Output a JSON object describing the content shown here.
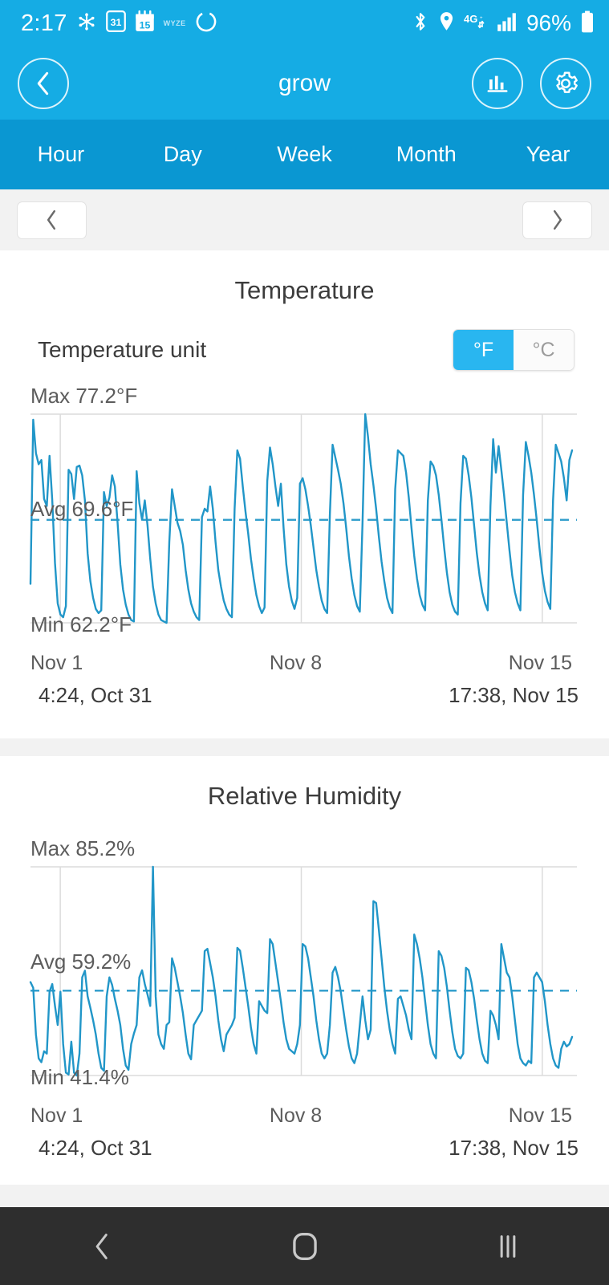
{
  "status_bar": {
    "time": "2:17",
    "battery_percent": "96%",
    "wyze_label": "WYZE",
    "icons": [
      "snowflake-icon",
      "sim-calendar-31-icon",
      "calendar-15-icon",
      "wyze-icon",
      "bixby-circle-icon",
      "bluetooth-icon",
      "location-pin-icon",
      "4g-data-icon",
      "signal-bars-icon",
      "battery-icon"
    ]
  },
  "app_bar": {
    "title": "grow",
    "back_label": "Back",
    "chart_button_label": "Chart",
    "settings_button_label": "Settings"
  },
  "tabs": {
    "items": [
      {
        "label": "Hour",
        "active": false
      },
      {
        "label": "Day",
        "active": false
      },
      {
        "label": "Week",
        "active": false
      },
      {
        "label": "Month",
        "active": true
      },
      {
        "label": "Year",
        "active": false
      }
    ]
  },
  "range_nav": {
    "prev_label": "Previous period",
    "next_label": "Next period"
  },
  "temperature": {
    "title": "Temperature",
    "unit_row_label": "Temperature unit",
    "unit_options": [
      {
        "label": "°F",
        "selected": true
      },
      {
        "label": "°C",
        "selected": false
      }
    ],
    "max_label": "Max 77.2°F",
    "avg_label": "Avg 69.6°F",
    "min_label": "Min 62.2°F",
    "x_ticks": [
      "Nov 1",
      "Nov 8",
      "Nov 15"
    ],
    "range_start": "4:24, Oct 31",
    "range_end": "17:38, Nov 15"
  },
  "humidity": {
    "title": "Relative Humidity",
    "max_label": "Max 85.2%",
    "avg_label": "Avg 59.2%",
    "min_label": "Min 41.4%",
    "x_ticks": [
      "Nov 1",
      "Nov 8",
      "Nov 15"
    ],
    "range_start": "4:24, Oct 31",
    "range_end": "17:38, Nov 15"
  },
  "android_nav": {
    "back_label": "Back",
    "home_label": "Home",
    "recents_label": "Recent apps"
  },
  "colors": {
    "header_blue": "#15ace4",
    "tab_blue": "#0a97d2",
    "accent_blue": "#29b6f0",
    "line_blue": "#2196c8",
    "page_bg": "#f2f2f2",
    "card_bg": "#ffffff",
    "text_dark": "#3c3c3c",
    "text_muted": "#5c5c5c",
    "nav_bar": "#2e2e2e"
  },
  "chart_data": [
    {
      "type": "line",
      "title": "Temperature",
      "id": "temperature",
      "ylabel": "°F",
      "xlabel": "",
      "ylim": [
        62.2,
        77.2
      ],
      "max": 77.2,
      "avg": 69.6,
      "min": 62.2,
      "unit": "°F",
      "grid": true,
      "gridlines_x": [
        "Nov 1",
        "Nov 8",
        "Nov 15"
      ],
      "avg_line": 69.6,
      "x_start": "4:24, Oct 31",
      "x_end": "17:38, Nov 15",
      "x_tick_labels": [
        "Nov 1",
        "Nov 8",
        "Nov 15"
      ],
      "legend": [],
      "description": "Daily sawtooth cycle: sharp rise to daytime peak with plateau, then steady decay to overnight minimum; 16 day-cycles across Oct 31 to Nov 15.",
      "series": [
        {
          "name": "Temperature",
          "color": "#2196c8",
          "values": [
            65.0,
            76.8,
            74.4,
            73.6,
            73.9,
            71.1,
            70.6,
            74.2,
            71.0,
            66.5,
            63.6,
            62.8,
            62.6,
            63.4,
            73.2,
            72.9,
            71.1,
            73.4,
            73.5,
            72.8,
            71.0,
            67.2,
            65.2,
            64.0,
            63.2,
            62.9,
            63.1,
            71.6,
            70.6,
            71.2,
            72.8,
            72.0,
            69.4,
            66.4,
            64.6,
            63.5,
            62.8,
            62.4,
            62.3,
            73.1,
            70.8,
            69.6,
            71.0,
            69.2,
            66.8,
            64.8,
            63.6,
            62.8,
            62.4,
            62.3,
            62.2,
            68.0,
            71.8,
            70.6,
            69.4,
            68.8,
            67.8,
            66.0,
            64.6,
            63.6,
            63.0,
            62.6,
            62.4,
            69.8,
            70.4,
            70.2,
            72.0,
            70.4,
            68.0,
            66.0,
            64.8,
            63.8,
            63.2,
            62.8,
            62.6,
            70.4,
            74.6,
            74.0,
            72.0,
            70.2,
            68.6,
            66.8,
            65.4,
            64.2,
            63.4,
            62.9,
            63.3,
            72.4,
            74.8,
            73.6,
            72.0,
            70.6,
            72.2,
            69.0,
            66.4,
            64.8,
            63.8,
            63.2,
            64.0,
            72.2,
            72.6,
            71.8,
            70.6,
            69.2,
            67.6,
            66.0,
            64.8,
            63.8,
            63.2,
            62.9,
            70.0,
            75.0,
            74.1,
            73.2,
            72.2,
            70.8,
            69.0,
            67.0,
            65.4,
            64.2,
            63.4,
            63.0,
            69.4,
            77.2,
            75.6,
            73.6,
            72.1,
            70.4,
            68.4,
            66.6,
            65.2,
            64.0,
            63.3,
            62.9,
            71.8,
            74.6,
            74.4,
            74.2,
            73.0,
            71.2,
            69.0,
            67.0,
            65.4,
            64.2,
            63.5,
            63.1,
            71.0,
            73.8,
            73.5,
            72.8,
            71.4,
            69.6,
            67.6,
            65.8,
            64.4,
            63.5,
            63.0,
            62.8,
            70.8,
            74.2,
            74.0,
            72.8,
            71.2,
            69.2,
            67.2,
            65.6,
            64.4,
            63.6,
            63.1,
            70.6,
            75.4,
            73.0,
            74.9,
            73.2,
            71.4,
            69.4,
            67.4,
            65.6,
            64.4,
            63.6,
            63.1,
            71.4,
            75.2,
            74.2,
            73.0,
            71.4,
            69.6,
            67.6,
            65.8,
            64.5,
            63.7,
            63.2,
            71.0,
            75.0,
            74.4,
            73.8,
            72.6,
            71.0,
            73.9,
            74.6
          ]
        }
      ]
    },
    {
      "type": "line",
      "title": "Relative Humidity",
      "id": "humidity",
      "ylabel": "%",
      "xlabel": "",
      "ylim": [
        41.4,
        85.2
      ],
      "max": 85.2,
      "avg": 59.2,
      "min": 41.4,
      "unit": "%",
      "grid": true,
      "gridlines_x": [
        "Nov 1",
        "Nov 8",
        "Nov 15"
      ],
      "avg_line": 59.2,
      "x_start": "4:24, Oct 31",
      "x_end": "17:38, Nov 15",
      "x_tick_labels": [
        "Nov 1",
        "Nov 8",
        "Nov 15"
      ],
      "legend": [],
      "description": "Square-wave daily cycle between ~45% nightly lows and ~70% daytime highs, with one isolated spike to the 85.2% maximum around Nov 2.",
      "series": [
        {
          "name": "Relative Humidity",
          "color": "#2196c8",
          "values": [
            61.0,
            59.8,
            50.0,
            45.0,
            44.2,
            46.5,
            46.0,
            59.0,
            60.6,
            56.0,
            52.0,
            59.0,
            48.0,
            42.0,
            41.6,
            48.5,
            42.0,
            41.4,
            46.0,
            62.0,
            63.4,
            58.0,
            55.6,
            53.0,
            50.0,
            46.0,
            43.0,
            42.4,
            58.0,
            62.0,
            60.4,
            57.5,
            55.0,
            52.0,
            47.0,
            43.5,
            42.6,
            48.0,
            50.2,
            52.0,
            62.0,
            63.5,
            60.6,
            58.4,
            56.0,
            85.2,
            58.0,
            50.0,
            48.0,
            47.0,
            52.0,
            52.6,
            66.0,
            64.0,
            61.0,
            58.0,
            54.5,
            50.0,
            46.0,
            44.8,
            52.0,
            53.0,
            54.0,
            55.0,
            67.5,
            68.0,
            65.0,
            62.0,
            58.0,
            53.0,
            49.0,
            46.5,
            50.0,
            51.0,
            52.0,
            53.5,
            68.2,
            67.6,
            64.0,
            60.0,
            56.0,
            51.5,
            48.0,
            46.0,
            57.0,
            56.0,
            55.0,
            54.5,
            70.0,
            69.0,
            65.0,
            61.0,
            57.0,
            52.5,
            49.0,
            47.0,
            46.5,
            46.0,
            48.0,
            52.0,
            69.0,
            68.5,
            66.0,
            62.0,
            58.0,
            53.0,
            49.0,
            46.0,
            45.0,
            46.0,
            52.0,
            63.0,
            64.2,
            62.0,
            59.0,
            55.0,
            51.0,
            47.5,
            45.0,
            44.0,
            46.0,
            52.0,
            58.0,
            53.0,
            49.0,
            51.0,
            78.0,
            77.6,
            72.0,
            66.0,
            60.0,
            55.0,
            51.0,
            48.0,
            46.0,
            57.5,
            58.0,
            56.0,
            54.0,
            51.0,
            49.0,
            71.0,
            69.0,
            66.0,
            62.0,
            57.0,
            52.0,
            48.0,
            46.0,
            45.0,
            67.5,
            66.5,
            64.0,
            60.0,
            55.0,
            50.5,
            47.0,
            45.5,
            45.0,
            46.0,
            64.0,
            63.5,
            61.0,
            57.5,
            53.0,
            49.0,
            46.0,
            44.5,
            44.0,
            55.0,
            54.0,
            52.0,
            49.0,
            69.0,
            66.0,
            63.0,
            62.0,
            58.0,
            53.0,
            48.0,
            45.0,
            44.0,
            43.5,
            44.5,
            44.0,
            62.0,
            63.0,
            62.0,
            61.0,
            57.0,
            52.0,
            48.0,
            45.0,
            43.5,
            43.0,
            47.0,
            48.5,
            47.5,
            48.0,
            49.5
          ]
        }
      ]
    }
  ]
}
